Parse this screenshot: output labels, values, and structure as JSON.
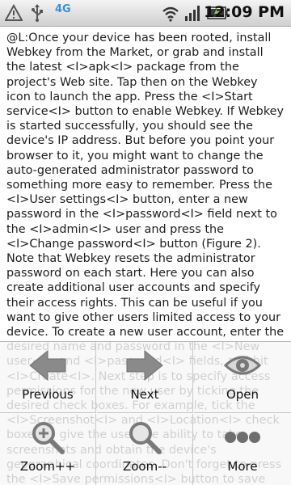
{
  "status_bar": {
    "icons": [
      "warning-icon",
      "usb-icon",
      "4g-icon",
      "wifi-icon",
      "signal-icon",
      "battery-icon"
    ],
    "network_label": "4G",
    "time": "12:09 PM"
  },
  "article": {
    "text": "@L:Once your device has been rooted, install Webkey from the Market, or grab and install the latest <I>apk<I> package from the project's Web site. Tap then on the Webkey icon to launch the app. Press the <I>Start service<I> button to enable Webkey. If Webkey is started successfully, you should see the device's IP address. But before you point your browser to it, you might want to change the auto-generated administrator password to something more easy to remember. Press the <I>User settings<I> button, enter a new password in the <I>password<I> field next to the <I>admin<I> user and press the <I>Change password<I> button (Figure 2). Note that Webkey resets the administrator password on each start. Here you can also create additional user accounts and specify their access rights. This can be useful if you want to give other users limited access to your device. To create a new user account, enter the desired name and password in the <I>New user<I> and <I>password<I> fields, and hit <I>Create<I>. Next step is to specify access permissions for the new user by ticking the desired check boxes. For example, tick the <I>Screenshot<I> and <I>Location<I> check boxes to give the user the ability to take screenshots and obtain the device's geographical coordinates. Don't forget to press the <I>Save permissions<I> button to save the specified access rights."
  },
  "menu": {
    "items": [
      {
        "label": "Previous",
        "icon": "arrow-left-icon"
      },
      {
        "label": "Next",
        "icon": "arrow-right-icon"
      },
      {
        "label": "Open",
        "icon": "eye-icon"
      },
      {
        "label": "Zoom++",
        "icon": "zoom-in-icon"
      },
      {
        "label": "Zoom--",
        "icon": "zoom-out-icon"
      },
      {
        "label": "More",
        "icon": "more-icon"
      }
    ]
  },
  "colors": {
    "icon_gray": "#8a8a8a",
    "accent_blue": "#3b8fd6"
  }
}
